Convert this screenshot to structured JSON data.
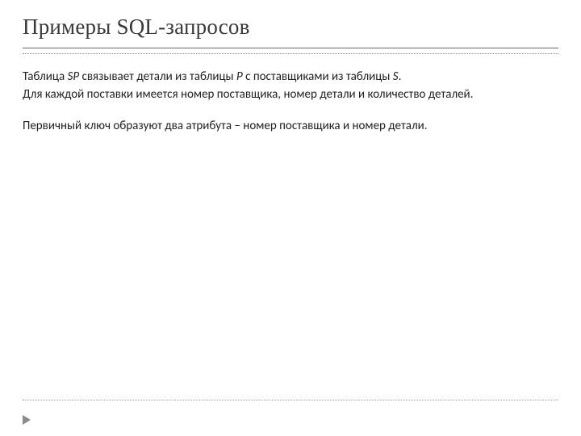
{
  "title": "Примеры SQL-запросов",
  "body": {
    "line1_pre": "Таблица ",
    "line1_sp": "SP",
    "line1_mid1": " связывает детали из таблицы ",
    "line1_p": "P",
    "line1_mid2": " с поставщиками из таблицы ",
    "line1_s": "S",
    "line1_end": ".",
    "line2": "Для каждой поставки имеется номер поставщика, номер детали и количество деталей.",
    "line3": "Первичный ключ образуют два атрибута – номер поставщика и номер детали."
  }
}
